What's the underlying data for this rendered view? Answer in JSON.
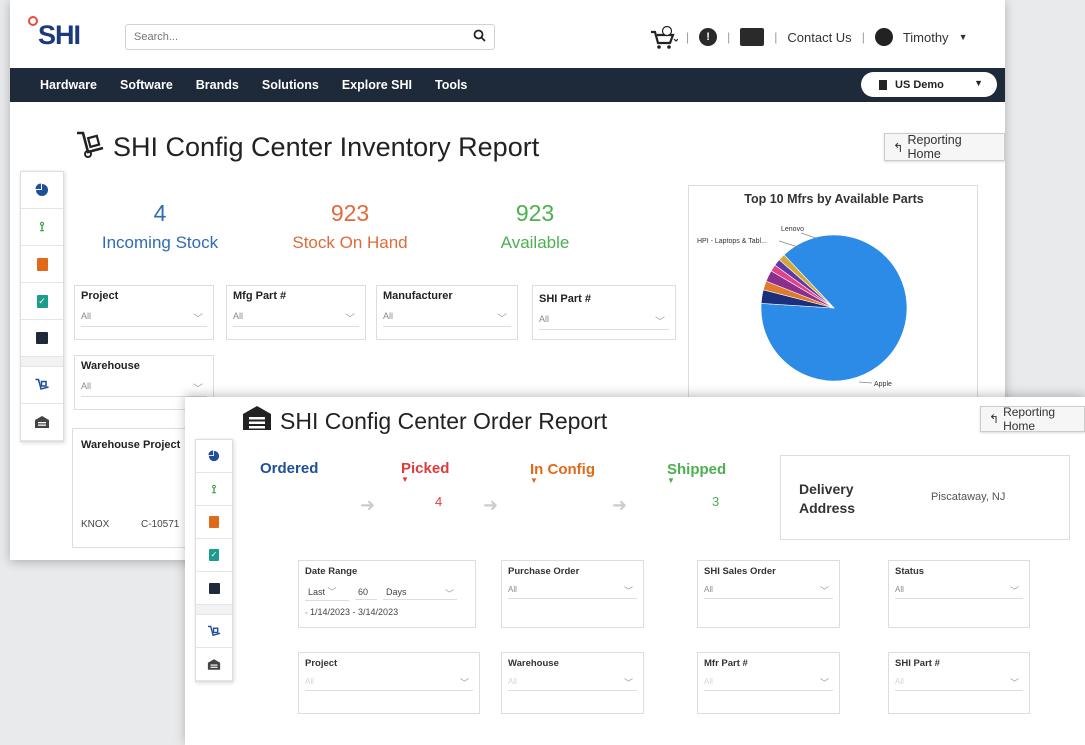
{
  "brand": "SHI",
  "header": {
    "search_placeholder": "Search...",
    "contact": "Contact Us",
    "user": "Timothy"
  },
  "nav": [
    "Hardware",
    "Software",
    "Brands",
    "Solutions",
    "Explore SHI",
    "Tools"
  ],
  "account_selector": "US Demo",
  "inventory": {
    "title": "SHI Config Center Inventory Report",
    "reporting_home": "Reporting Home",
    "stats": [
      {
        "value": "4",
        "label": "Incoming Stock",
        "color": "#2e6cb3"
      },
      {
        "value": "923",
        "label": "Stock On Hand",
        "color": "#e06a3a"
      },
      {
        "value": "923",
        "label": "Available",
        "color": "#4caf50"
      }
    ],
    "filters": [
      {
        "label": "Project",
        "value": "All"
      },
      {
        "label": "Mfg Part #",
        "value": "All"
      },
      {
        "label": "Manufacturer",
        "value": "All"
      },
      {
        "label": "SHI Part #",
        "value": "All"
      },
      {
        "label": "Warehouse",
        "value": "All"
      }
    ],
    "table": {
      "headers": [
        "Warehouse",
        "Project"
      ],
      "row": [
        "KNOX",
        "C-10571"
      ]
    }
  },
  "chart_data": {
    "type": "pie",
    "title": "Top 10 Mfrs by Available Parts",
    "labels": [
      "Apple",
      "HPI - Laptops & Tabl...",
      "Lenovo"
    ],
    "slices": [
      {
        "name": "Apple",
        "value": 88.0,
        "color": "#2b8be6"
      },
      {
        "name": "HPI - Laptops & Tabl...",
        "value": 3.0,
        "color": "#1b2f7a"
      },
      {
        "name": "",
        "value": 2.0,
        "color": "#e07a2e"
      },
      {
        "name": "",
        "value": 2.5,
        "color": "#8a2f8c"
      },
      {
        "name": "",
        "value": 1.5,
        "color": "#e0438a"
      },
      {
        "name": "Lenovo",
        "value": 1.5,
        "color": "#5c3aa3"
      },
      {
        "name": "",
        "value": 1.5,
        "color": "#d2a83a"
      }
    ]
  },
  "order": {
    "title": "SHI Config Center Order Report",
    "reporting_home": "Reporting Home",
    "stages": [
      {
        "label": "Ordered",
        "value": "",
        "color": "#1f4e9a"
      },
      {
        "label": "Picked",
        "value": "4",
        "color": "#e03b3b"
      },
      {
        "label": "In Config",
        "value": "",
        "color": "#e06a1a"
      },
      {
        "label": "Shipped",
        "value": "3",
        "color": "#4caf50"
      }
    ],
    "delivery": {
      "label_line1": "Delivery",
      "label_line2": "Address",
      "value": "Piscataway, NJ"
    },
    "date_range": {
      "label": "Date Range",
      "mode": "Last",
      "amount": "60",
      "unit": "Days",
      "dates": "1/14/2023 - 3/14/2023"
    },
    "filters": [
      {
        "label": "Purchase Order",
        "value": "All"
      },
      {
        "label": "SHI Sales Order",
        "value": "All"
      },
      {
        "label": "Status",
        "value": "All"
      },
      {
        "label": "Project",
        "value": "All"
      },
      {
        "label": "Warehouse",
        "value": "All"
      },
      {
        "label": "Mfr Part #",
        "value": "All"
      },
      {
        "label": "SHI Part #",
        "value": "All"
      }
    ]
  }
}
